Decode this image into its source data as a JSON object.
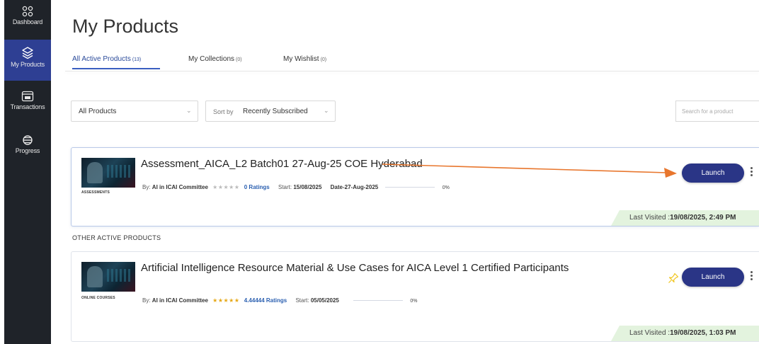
{
  "sidebar": {
    "items": [
      {
        "label": "Dashboard",
        "icon": "dashboard-icon",
        "active": false
      },
      {
        "label": "My Products",
        "icon": "layers-icon",
        "active": true
      },
      {
        "label": "Transactions",
        "icon": "transactions-icon",
        "active": false
      },
      {
        "label": "Progress",
        "icon": "progress-icon",
        "active": false
      }
    ]
  },
  "header": {
    "title": "My Products",
    "tabs": [
      {
        "label": "All Active Products",
        "count": "(13)",
        "active": true
      },
      {
        "label": "My Collections",
        "count": "(0)",
        "active": false
      },
      {
        "label": "My Wishlist",
        "count": "(0)",
        "active": false
      }
    ]
  },
  "filters": {
    "category_value": "All Products",
    "sort_label": "Sort by",
    "sort_value": "Recently Subscribed",
    "search_placeholder": "Search for a product"
  },
  "products": [
    {
      "title": "Assessment_AICA_L2 Batch01 27-Aug-25 COE Hyderabad",
      "tag": "ASSESSMENTS",
      "by_label": "By:",
      "author": "AI in ICAI Committee",
      "stars": "★★★★★",
      "ratings": "0 Ratings",
      "start_label": "Start:",
      "start_date": "15/08/2025",
      "extra": "Date-27-Aug-2025",
      "progress": 0,
      "progress_text": "0%",
      "launch_label": "Launch",
      "last_visited_label": "Last Visited :",
      "last_visited": "19/08/2025, 2:49 PM"
    },
    {
      "title": "Artificial Intelligence Resource Material & Use Cases for AICA Level 1 Certified Participants",
      "tag": "ONLINE COURSES",
      "by_label": "By:",
      "author": "AI in ICAI Committee",
      "stars": "★★★★★",
      "ratings": "4.44444 Ratings",
      "start_label": "Start:",
      "start_date": "05/05/2025",
      "progress": 0,
      "progress_text": "0%",
      "launch_label": "Launch",
      "last_visited_label": "Last Visited :",
      "last_visited": "19/08/2025, 1:03 PM"
    }
  ],
  "sections": {
    "other_label": "OTHER ACTIVE PRODUCTS"
  },
  "colors": {
    "sidebar_bg": "#1f2329",
    "sidebar_active": "#2e3f93",
    "launch_button": "#2a3586",
    "annotation_arrow": "#e8762d",
    "last_visited_bg": "#e3f3de"
  }
}
